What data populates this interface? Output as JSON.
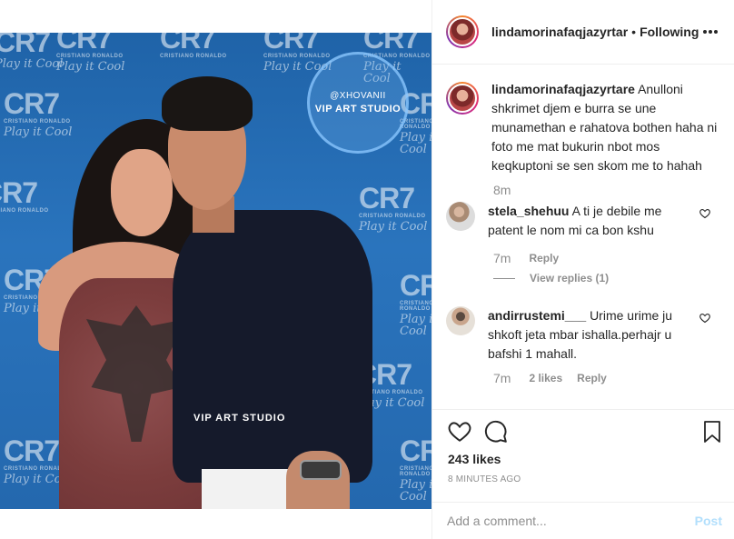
{
  "photo": {
    "watermark_circle_handle": "@XHOVANII",
    "watermark_circle_studio": "VIP ART STUDIO",
    "watermark_bottom": "VIP ART STUDIO",
    "backdrop_logo": "CR7",
    "backdrop_sub": "CRISTIANO RONALDO",
    "backdrop_script": "Play it Cool"
  },
  "header": {
    "username": "lindamorinafaqjazyrtar",
    "separator": "•",
    "follow_status": "Following",
    "more_icon": "more-options-icon"
  },
  "caption": {
    "username": "lindamorinafaqjazyrtare",
    "text": "Anulloni shkrimet djem e burra se une munamethan e rahatova bothen haha ni foto me mat bukurin nbot mos keqkuptoni se sen skom me to hahah",
    "time": "8m"
  },
  "comments": [
    {
      "username": "stela_shehuu",
      "text": "A ti je debile me patent le nom mi ca bon kshu",
      "time": "7m",
      "reply_label": "Reply",
      "view_replies": "View replies (1)"
    },
    {
      "username": "andirrustemi___",
      "text": "Urime urime ju shkoft jeta mbar ishalla.perhajr u bafshi 1 mahall.",
      "time": "7m",
      "likes": "2 likes",
      "reply_label": "Reply"
    }
  ],
  "actions": {
    "likes": "243 likes",
    "time_ago": "8 MINUTES AGO"
  },
  "add_comment": {
    "placeholder": "Add a comment...",
    "post_label": "Post"
  },
  "colors": {
    "post_button_disabled": "#b2dffc",
    "muted_text": "#8e8e8e",
    "text": "#262626",
    "border": "#efefef"
  }
}
